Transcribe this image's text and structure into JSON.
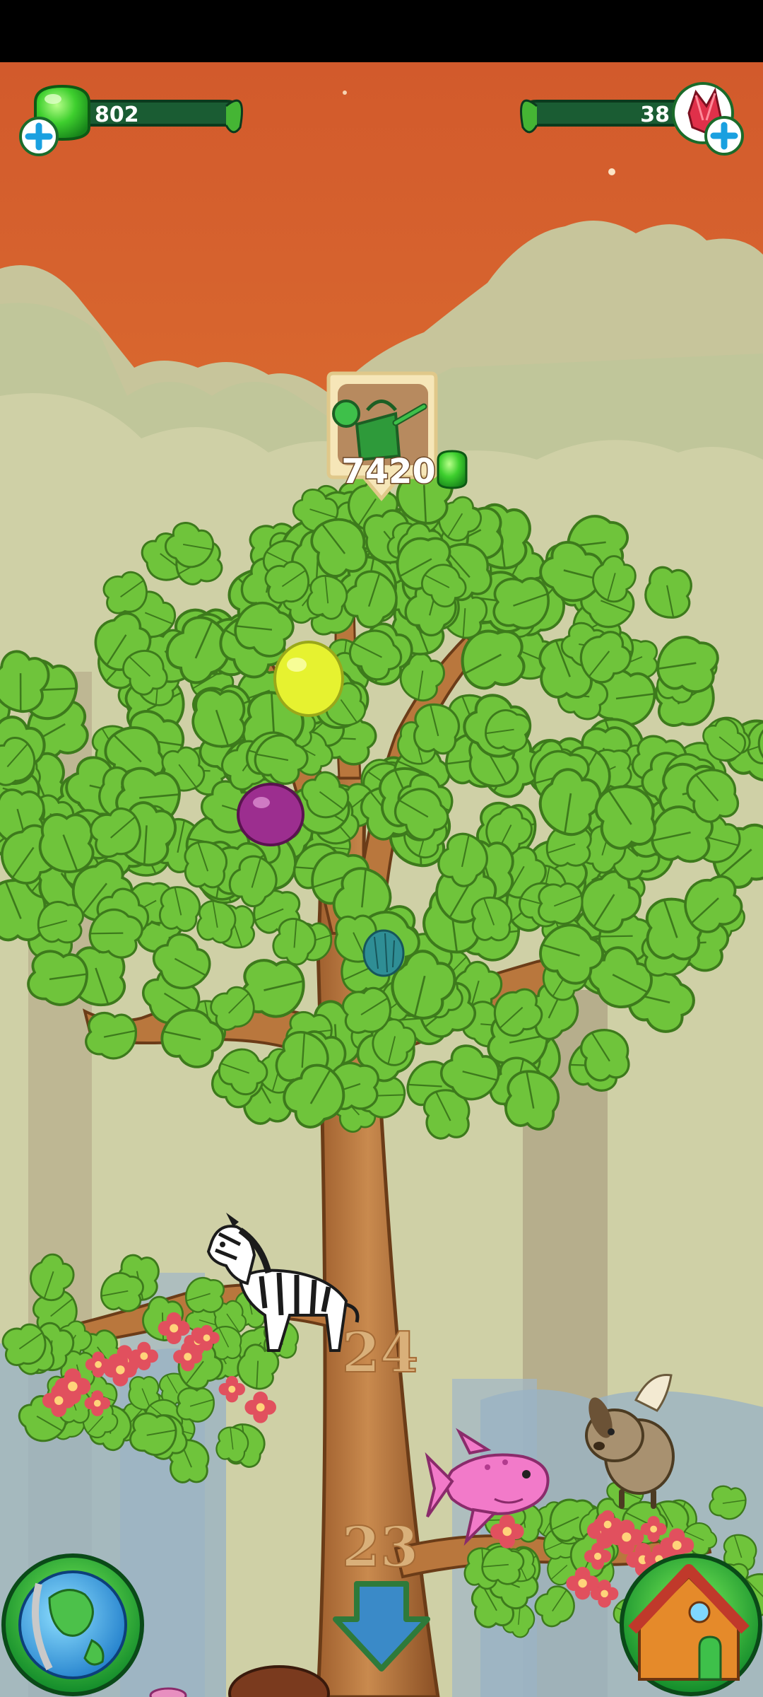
{
  "status_bar": {
    "color": "#000000"
  },
  "hud": {
    "gems": {
      "value": "802",
      "icon": "green-gem-icon",
      "add_icon": "plus-icon"
    },
    "crystals": {
      "value": "38",
      "icon": "red-crystal-icon",
      "add_icon": "plus-icon"
    }
  },
  "shop_badge": {
    "price": "7420",
    "item_icon": "watering-can-icon",
    "currency_icon": "green-gem-icon"
  },
  "tree": {
    "fruits": [
      "yellow-fruit",
      "purple-fruit",
      "teal-fruit"
    ],
    "branches": [
      {
        "level": "24",
        "pet": "zebra"
      },
      {
        "level": "23",
        "pets": [
          "pink-fish",
          "winged-dog"
        ]
      }
    ]
  },
  "bottom_bar": {
    "left": "globe-button",
    "center": "scroll-down-arrow",
    "right": "house-button"
  },
  "colors": {
    "sky_top": "#d4612d",
    "sky_mid": "#e68a3a",
    "hud_green": "#1a5c33",
    "trunk": "#b8743b",
    "leaf": "#6cc23a"
  }
}
